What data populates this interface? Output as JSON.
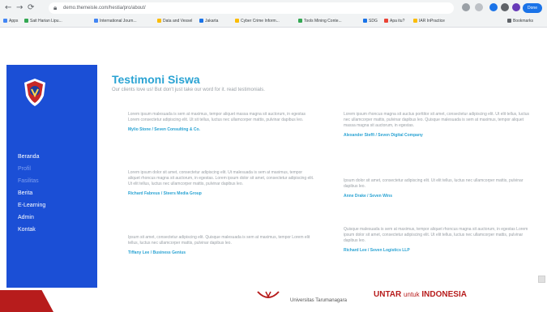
{
  "browser": {
    "url": "demo.themeisle.com/hestia/pro/about/",
    "back_icon": "arrow-left",
    "forward_icon": "arrow-right",
    "reload_icon": "reload",
    "profile_label": "Done",
    "bookmarks": [
      {
        "label": "Apps",
        "color": "#4285f4"
      },
      {
        "label": "Sait Harian Lipu...",
        "color": "#34a853"
      },
      {
        "label": "International Journ...",
        "color": "#4285f4"
      },
      {
        "label": "Data and Vessel",
        "color": "#fbbc05"
      },
      {
        "label": "Jakarta",
        "color": "#1a73e8"
      },
      {
        "label": "Cyber Crime Inform...",
        "color": "#fbbc05"
      },
      {
        "label": "Tools Mining Conte...",
        "color": "#34a853"
      },
      {
        "label": "SDG",
        "color": "#1a73e8"
      },
      {
        "label": "Apa itu?",
        "color": "#ea4335"
      },
      {
        "label": "IAR InPractice",
        "color": "#fbbc05"
      },
      {
        "label": "Bookmarks",
        "color": "#5f6368"
      }
    ]
  },
  "sidebar": {
    "items": [
      {
        "label": "Beranda",
        "active": true
      },
      {
        "label": "Profil",
        "active": false
      },
      {
        "label": "Fasilitas",
        "active": false
      },
      {
        "label": "Berita",
        "active": true
      },
      {
        "label": "E-Learning",
        "active": true
      },
      {
        "label": "Admin",
        "active": true
      },
      {
        "label": "Kontak",
        "active": true
      }
    ]
  },
  "content": {
    "title": "Testimoni Siswa",
    "subtitle": "Our clients love us! But don't just take our word for it. read testimonials.",
    "testimonials": [
      {
        "text": "Lorem ipsum malesuada is sem at maximus, tempor aliquet massa magna sit auctorum, in egestas Lorem consectetur adipiscing elit. Ut sit tellus, luctus nec ullamcorper mattis, pulvinar dapibus leo.",
        "author": "Mylio Stone / Seven Consulting & Co."
      },
      {
        "text": "Lorem ipsum rhoncus magna sit auctus porttitor sit amet, consectetur adipiscing elit. Ut elit tellus, luctus nec ullamcorper mattis, pulvinar dapibus leo. Quisque malesuada is sem at maximus, tempor aliquet massa magna sit auctorum, in egestas.",
        "author": "Alexander Steffi / Seven Digital Company"
      },
      {
        "text": "Lorem ipsum dolor sit amet, consectetur adipiscing elit. Ut malesuada is sem at maximus, tempor aliquet rhoncus magna sit auctorum, in egestas. Lorem ipsum dolor sit amet, consectetur adipiscing elit. Ut elit tellus, luctus nec ullamcorper mattis, pulvinar dapibus leo.",
        "author": "Richard Fabreus / Steers Media Group"
      },
      {
        "text": "Ipsum dolor sit amet, consectetur adipiscing elit. Ut elit tellus, luctus nec ullamcorper mattis, pulvinar dapibus leo.",
        "author": "Anne Drake / Seven Wins"
      },
      {
        "text": "Ipsum sit amet, consectetur adipiscing elit. Quisque malesuada is sem at maximus, tempor Lorem elit tellus, luctus nec ullamcorper mattis, pulvinar dapibus leo.",
        "author": "Tiffany Lee / Business Genius"
      },
      {
        "text": "Quisque malesuada is sem at maximus, tempor aliquet rhoncus magna sit auctorum, in egestas Lorem ipsum dolor sit amet, consectetur adipiscing elit. Ut elit tellus, luctus nec ullamcorper mattis, pulvinar dapibus leo.",
        "author": "Richard Lee / Seven Logistics LLP"
      }
    ]
  },
  "footer": {
    "university_name": "Universitas Tarumanagara",
    "slogan_brand": "UNTAR",
    "slogan_mid": "untuk",
    "slogan_end": "INDONESIA"
  },
  "colors": {
    "accent": "#2aa3d3",
    "sidebar": "#1b4fd6",
    "brand_red": "#b71c1c"
  }
}
